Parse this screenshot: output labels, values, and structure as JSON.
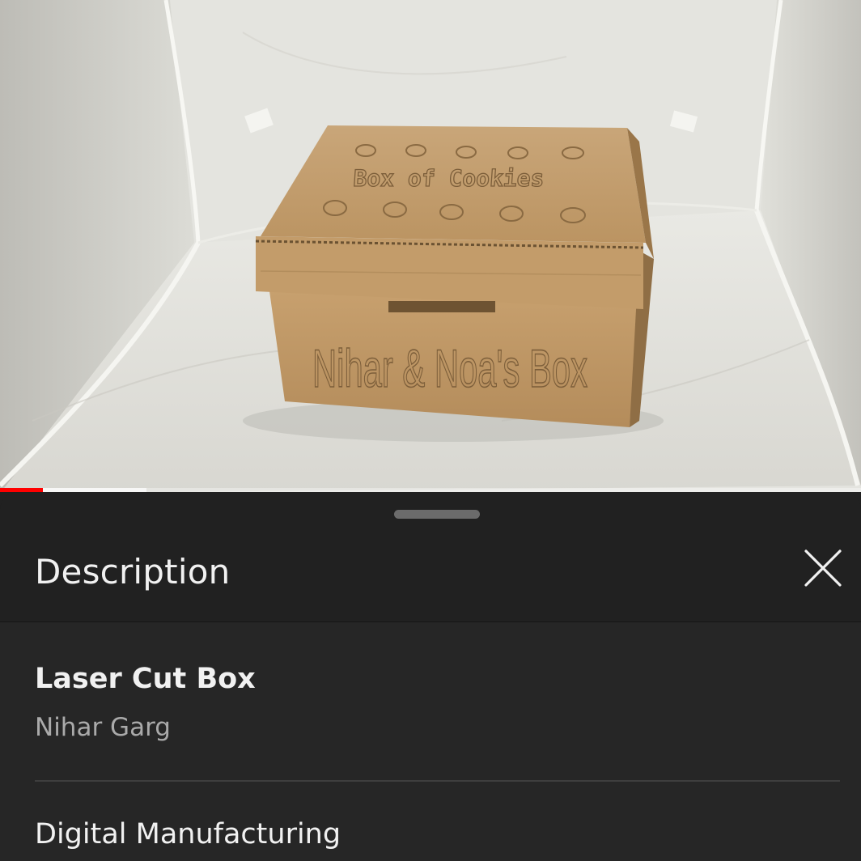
{
  "video": {
    "box_lid_text": "Box of Cookies",
    "box_side_text": "Nihar & Noa's Box",
    "progress_fraction": 0.05,
    "buffered_fraction": 0.17,
    "progress_color": "#ff0000"
  },
  "sheet": {
    "title": "Description",
    "close_icon": "close-icon"
  },
  "description": {
    "video_title": "Laser Cut Box",
    "channel": "Nihar Garg",
    "section": "Digital Manufacturing"
  }
}
